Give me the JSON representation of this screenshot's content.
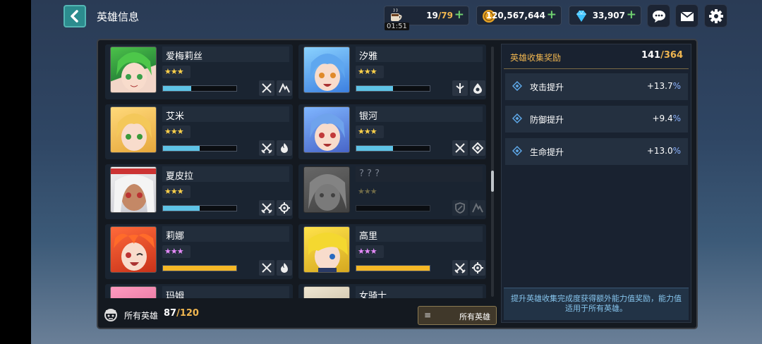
{
  "header": {
    "title": "英雄信息"
  },
  "resources": {
    "stamina": "19",
    "stamina_max": "/79",
    "timer": "01:51",
    "gold": "120,567,644",
    "gems": "33,907"
  },
  "heroes": [
    {
      "name": "爱梅莉丝",
      "stars": "★★★",
      "star_color": "gold",
      "progress": 0.38,
      "bar_color": "#5ec3e6"
    },
    {
      "name": "汐雅",
      "stars": "★★★",
      "star_color": "gold",
      "progress": 0.5,
      "bar_color": "#5ec3e6"
    },
    {
      "name": "艾米",
      "stars": "★★★",
      "star_color": "gold",
      "progress": 0.5,
      "bar_color": "#5ec3e6"
    },
    {
      "name": "银河",
      "stars": "★★★",
      "star_color": "gold",
      "progress": 0.5,
      "bar_color": "#5ec3e6"
    },
    {
      "name": "夏皮拉",
      "stars": "★★★",
      "star_color": "gold",
      "progress": 0.5,
      "bar_color": "#5ec3e6"
    },
    {
      "name": "? ? ?",
      "stars": "★★★",
      "star_color": "dim",
      "progress": 0,
      "bar_color": "#333"
    },
    {
      "name": "莉娜",
      "stars": "★★★",
      "star_color": "pink",
      "progress": 1,
      "bar_color": "#f5b826"
    },
    {
      "name": "高里",
      "stars": "★★★",
      "star_color": "pink",
      "progress": 1,
      "bar_color": "#f5b826"
    },
    {
      "name": "玛姆",
      "stars": "",
      "star_color": "gold",
      "progress": 0,
      "bar_color": "#333"
    },
    {
      "name": "女骑士",
      "stars": "",
      "star_color": "gold",
      "progress": 0,
      "bar_color": "#333"
    }
  ],
  "footer": {
    "all_label": "所有英雄",
    "owned": "87",
    "total": "/120",
    "filter_label": "所有英雄"
  },
  "collection": {
    "title": "英雄收集奖励",
    "owned": "141",
    "total": "/364",
    "bonuses": [
      {
        "label": "攻击提升",
        "value": "+13.7",
        "unit": "%"
      },
      {
        "label": "防御提升",
        "value": "+9.4",
        "unit": "%"
      },
      {
        "label": "生命提升",
        "value": "+13.0",
        "unit": "%"
      }
    ],
    "description": "提升英雄收集完成度获得额外能力值奖励，能力值适用于所有英雄。"
  },
  "colors": {
    "accent": "#f0b650",
    "teal": "#2c8c8e",
    "info": "#86c4ec"
  }
}
